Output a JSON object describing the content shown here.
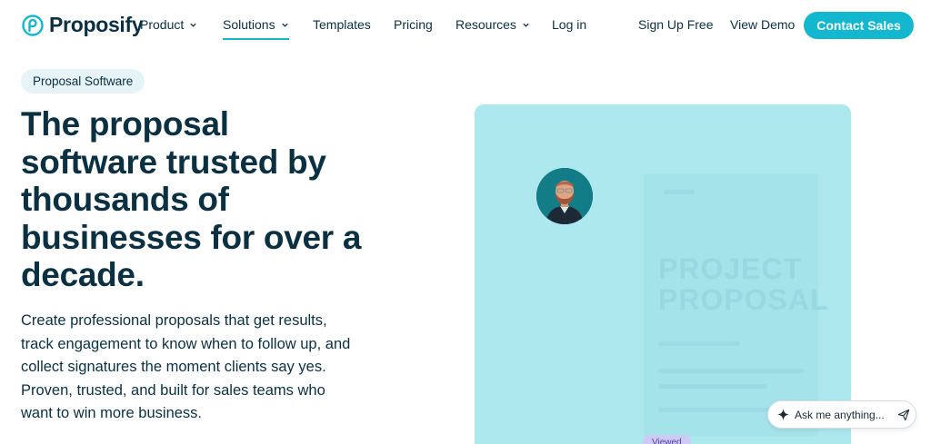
{
  "brand": {
    "name": "Proposify",
    "color": "#13b8cf",
    "text_color": "#0b3042"
  },
  "nav": {
    "items": [
      {
        "label": "Product",
        "dropdown": true
      },
      {
        "label": "Solutions",
        "dropdown": true,
        "active": true
      },
      {
        "label": "Templates",
        "dropdown": false
      },
      {
        "label": "Pricing",
        "dropdown": false
      },
      {
        "label": "Resources",
        "dropdown": true
      },
      {
        "label": "Log in",
        "dropdown": false
      }
    ],
    "signup": "Sign Up Free",
    "demo": "View Demo",
    "contact": "Contact Sales"
  },
  "hero": {
    "badge": "Proposal Software",
    "headline": "The proposal software trusted by thousands of businesses for over a decade.",
    "lead": "Create professional proposals that get results, track engagement to know when to follow up, and collect signatures the moment clients say yes. Proven, trusted, and built for sales teams who want to win more business.",
    "card_color": "#ade8ef",
    "doc_title": "PROJECT PROPOSAL",
    "viewed": "Viewed"
  },
  "assistant": {
    "placeholder": "Ask me anything...",
    "icons": [
      "sparkle-icon",
      "send-icon"
    ]
  }
}
